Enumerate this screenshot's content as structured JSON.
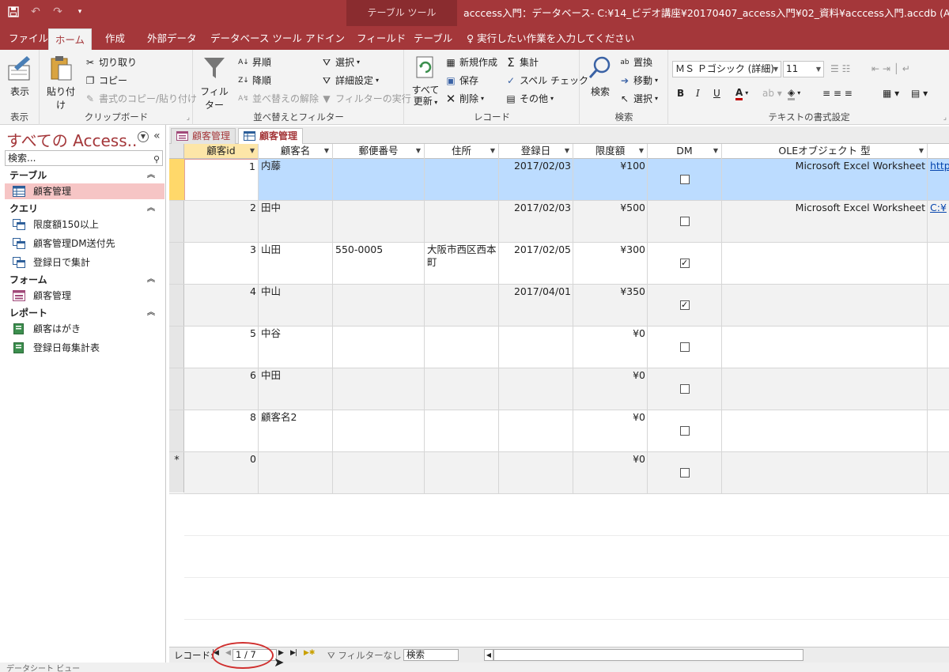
{
  "app": {
    "context_tab": "テーブル ツール",
    "window_title": "acccess入門：データベース- C:¥14_ビデオ講座¥20170407_access入門¥02_資料¥acccess入門.accdb (Access 2007"
  },
  "ribbon_tabs": {
    "file": "ファイル",
    "home": "ホーム",
    "create": "作成",
    "external": "外部データ",
    "dbtools": "データベース ツール",
    "addin": "アドイン",
    "field": "フィールド",
    "table": "テーブル",
    "tell_me": "実行したい作業を入力してください"
  },
  "ribbon": {
    "view_group": {
      "view": "表示",
      "name": "表示"
    },
    "clipboard": {
      "paste": "貼り付け",
      "cut": "切り取り",
      "copy": "コピー",
      "format_painter": "書式のコピー/貼り付け",
      "name": "クリップボード"
    },
    "sort_filter": {
      "filter": "フィルター",
      "asc": "昇順",
      "desc": "降順",
      "remove_sort": "並べ替えの解除",
      "selection": "選択",
      "advanced": "詳細設定",
      "toggle_filter": "フィルターの実行",
      "name": "並べ替えとフィルター"
    },
    "records": {
      "refresh_line1": "すべて",
      "refresh_line2": "更新",
      "new": "新規作成",
      "save": "保存",
      "delete": "削除",
      "totals": "集計",
      "spelling": "スペル チェック",
      "more": "その他",
      "name": "レコード"
    },
    "find": {
      "find": "検索",
      "replace": "置換",
      "goto": "移動",
      "select": "選択",
      "name": "検索"
    },
    "text_format": {
      "font": "ＭＳ Ｐゴシック (詳細)",
      "size": "11",
      "bold": "B",
      "italic": "I",
      "underline": "U",
      "name": "テキストの書式設定"
    }
  },
  "nav": {
    "header": "すべての Access...",
    "search_placeholder": "検索...",
    "categories": {
      "tables": "テーブル",
      "queries": "クエリ",
      "forms": "フォーム",
      "reports": "レポート"
    },
    "items": {
      "table_customer": "顧客管理",
      "query_limit": "限度額150以上",
      "query_dm": "顧客管理DM送付先",
      "query_regdate": "登録日で集計",
      "form_customer": "顧客管理",
      "report_postcard": "顧客はがき",
      "report_regdate": "登録日毎集計表"
    }
  },
  "doc_tabs": [
    "顧客管理",
    "顧客管理"
  ],
  "table": {
    "columns": [
      "顧客id",
      "顧客名",
      "郵便番号",
      "住所",
      "登録日",
      "限度額",
      "DM",
      "OLEオブジェクト 型"
    ],
    "rows": [
      {
        "id": "1",
        "name": "内藤",
        "zip": "",
        "addr": "",
        "date": "2017/02/03",
        "limit": "¥100",
        "dm": false,
        "ole": "Microsoft Excel Worksheet",
        "link": "http"
      },
      {
        "id": "2",
        "name": "田中",
        "zip": "",
        "addr": "",
        "date": "2017/02/03",
        "limit": "¥500",
        "dm": false,
        "ole": "Microsoft Excel Worksheet",
        "link": "C:¥"
      },
      {
        "id": "3",
        "name": "山田",
        "zip": "550-0005",
        "addr": "大阪市西区西本町",
        "date": "2017/02/05",
        "limit": "¥300",
        "dm": true,
        "ole": "",
        "link": ""
      },
      {
        "id": "4",
        "name": "中山",
        "zip": "",
        "addr": "",
        "date": "2017/04/01",
        "limit": "¥350",
        "dm": true,
        "ole": "",
        "link": ""
      },
      {
        "id": "5",
        "name": "中谷",
        "zip": "",
        "addr": "",
        "date": "",
        "limit": "¥0",
        "dm": false,
        "ole": "",
        "link": ""
      },
      {
        "id": "6",
        "name": "中田",
        "zip": "",
        "addr": "",
        "date": "",
        "limit": "¥0",
        "dm": false,
        "ole": "",
        "link": ""
      },
      {
        "id": "8",
        "name": "顧客名2",
        "zip": "",
        "addr": "",
        "date": "",
        "limit": "¥0",
        "dm": false,
        "ole": "",
        "link": ""
      }
    ],
    "new_row": {
      "marker": "*",
      "id": "0",
      "limit": "¥0"
    }
  },
  "record_nav": {
    "label": "レコード:",
    "position": "1 / 7",
    "filter": "フィルターなし",
    "search": "検索"
  },
  "status": "データシート ビュー",
  "colors": {
    "accent": "#a4373a",
    "selected_row": "#bcdcff",
    "highlight_circle": "#d0302f"
  }
}
